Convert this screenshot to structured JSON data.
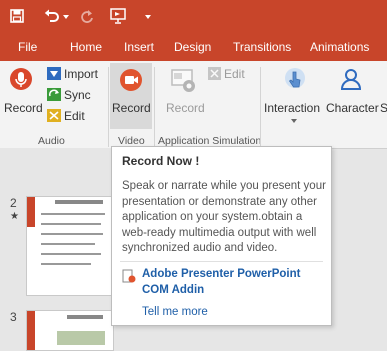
{
  "quick_access": {
    "save_icon": "save-icon",
    "undo_icon": "undo-icon",
    "redo_icon": "redo-icon",
    "present_icon": "present-icon",
    "customize_icon": "customize-qat-icon"
  },
  "tabs": [
    "File",
    "Home",
    "Insert",
    "Design",
    "Transitions",
    "Animations"
  ],
  "ribbon": {
    "audio": {
      "record_label": "Record",
      "import_label": "Import",
      "sync_label": "Sync",
      "edit_label": "Edit",
      "group_label": "Audio"
    },
    "video": {
      "record_label": "Record",
      "group_label": "Video"
    },
    "app_sim": {
      "record_label": "Record",
      "edit_label": "Edit",
      "group_label": "Application Simulation"
    },
    "interaction_label": "Interaction",
    "character_label": "Character",
    "next_label_partial": "S"
  },
  "slides": [
    {
      "number": "2",
      "star": "★"
    },
    {
      "number": "3"
    }
  ],
  "tooltip": {
    "title": "Record Now !",
    "body": "Speak or narrate while you present your presentation or demonstrate any other application on your system.obtain a web-ready multimedia output with well synchronized audio and video.",
    "addin_name": "Adobe Presenter PowerPoint COM Addin",
    "tell_me_more": "Tell me more"
  },
  "colors": {
    "accent": "#c8452a",
    "link": "#1f5fa8"
  }
}
